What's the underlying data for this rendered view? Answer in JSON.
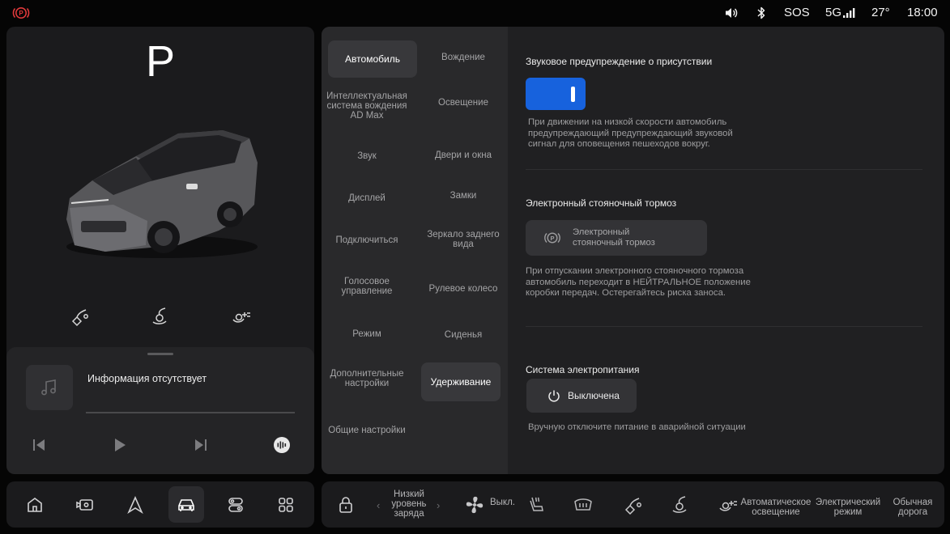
{
  "status_bar": {
    "parking_brake_icon": "parking-brake-warning",
    "volume_icon": "speaker",
    "bluetooth_icon": "bluetooth",
    "sos": "SOS",
    "network": "5G",
    "temperature": "27°",
    "time": "18:00",
    "warning_color": "#e0393b"
  },
  "vehicle": {
    "gear": "P",
    "quick_icons": [
      "fuel-door-open",
      "charge-port-left",
      "charge-port-right"
    ]
  },
  "media": {
    "track": "Информация отсутствует",
    "icons": [
      "music-note",
      "previous",
      "play",
      "next",
      "voice-assistant"
    ]
  },
  "menu": {
    "left": [
      "Автомобиль",
      "Интеллектуальная система вождения AD Max",
      "Звук",
      "Дисплей",
      "Подключиться",
      "Голосовое управление",
      "Режим",
      "Дополнительные настройки",
      "Общие настройки"
    ],
    "right": [
      "Вождение",
      "Освещение",
      "Двери и окна",
      "Замки",
      "Зеркало заднего вида",
      "Рулевое колесо",
      "Сиденья",
      "Удерживание"
    ],
    "active_left": "Автомобиль",
    "active_right": "Удерживание"
  },
  "content": {
    "presence_warning": {
      "title": "Звуковое предупреждение о присутствии",
      "enabled": true,
      "description_lines": [
        "При движении на низкой скорости автомобиль",
        "предупреждающий предупреждающий звуковой",
        "сигнал для оповещения пешеходов вокруг."
      ]
    },
    "epb": {
      "title": "Электронный стояночный тормоз",
      "button_lines": [
        "Электронный",
        "стояночный тормоз"
      ],
      "description_lines": [
        "При отпускании электронного стояночного тормоза",
        "автомобиль переходит в НЕЙТРАЛЬНОЕ положение",
        "коробки передач. Остерегайтесь риска заноса."
      ]
    },
    "power": {
      "title": "Система электропитания",
      "button": "Выключена",
      "description": "Вручную отключите питание в аварийной ситуации"
    },
    "accent_color": "#1762dd"
  },
  "dock": {
    "left_icons": [
      "home",
      "camera",
      "navigation",
      "vehicle",
      "apps-switch",
      "app-grid"
    ],
    "active": "vehicle",
    "right": {
      "lock_icon": "lock",
      "low_charge": [
        "Низкий",
        "уровень",
        "заряда"
      ],
      "fan_label": "Выкл.",
      "auto_light": [
        "Автоматическое",
        "освещение"
      ],
      "electric_mode": [
        "Электрический",
        "режим"
      ],
      "normal_road": [
        "Обычная",
        "дорога"
      ]
    }
  }
}
